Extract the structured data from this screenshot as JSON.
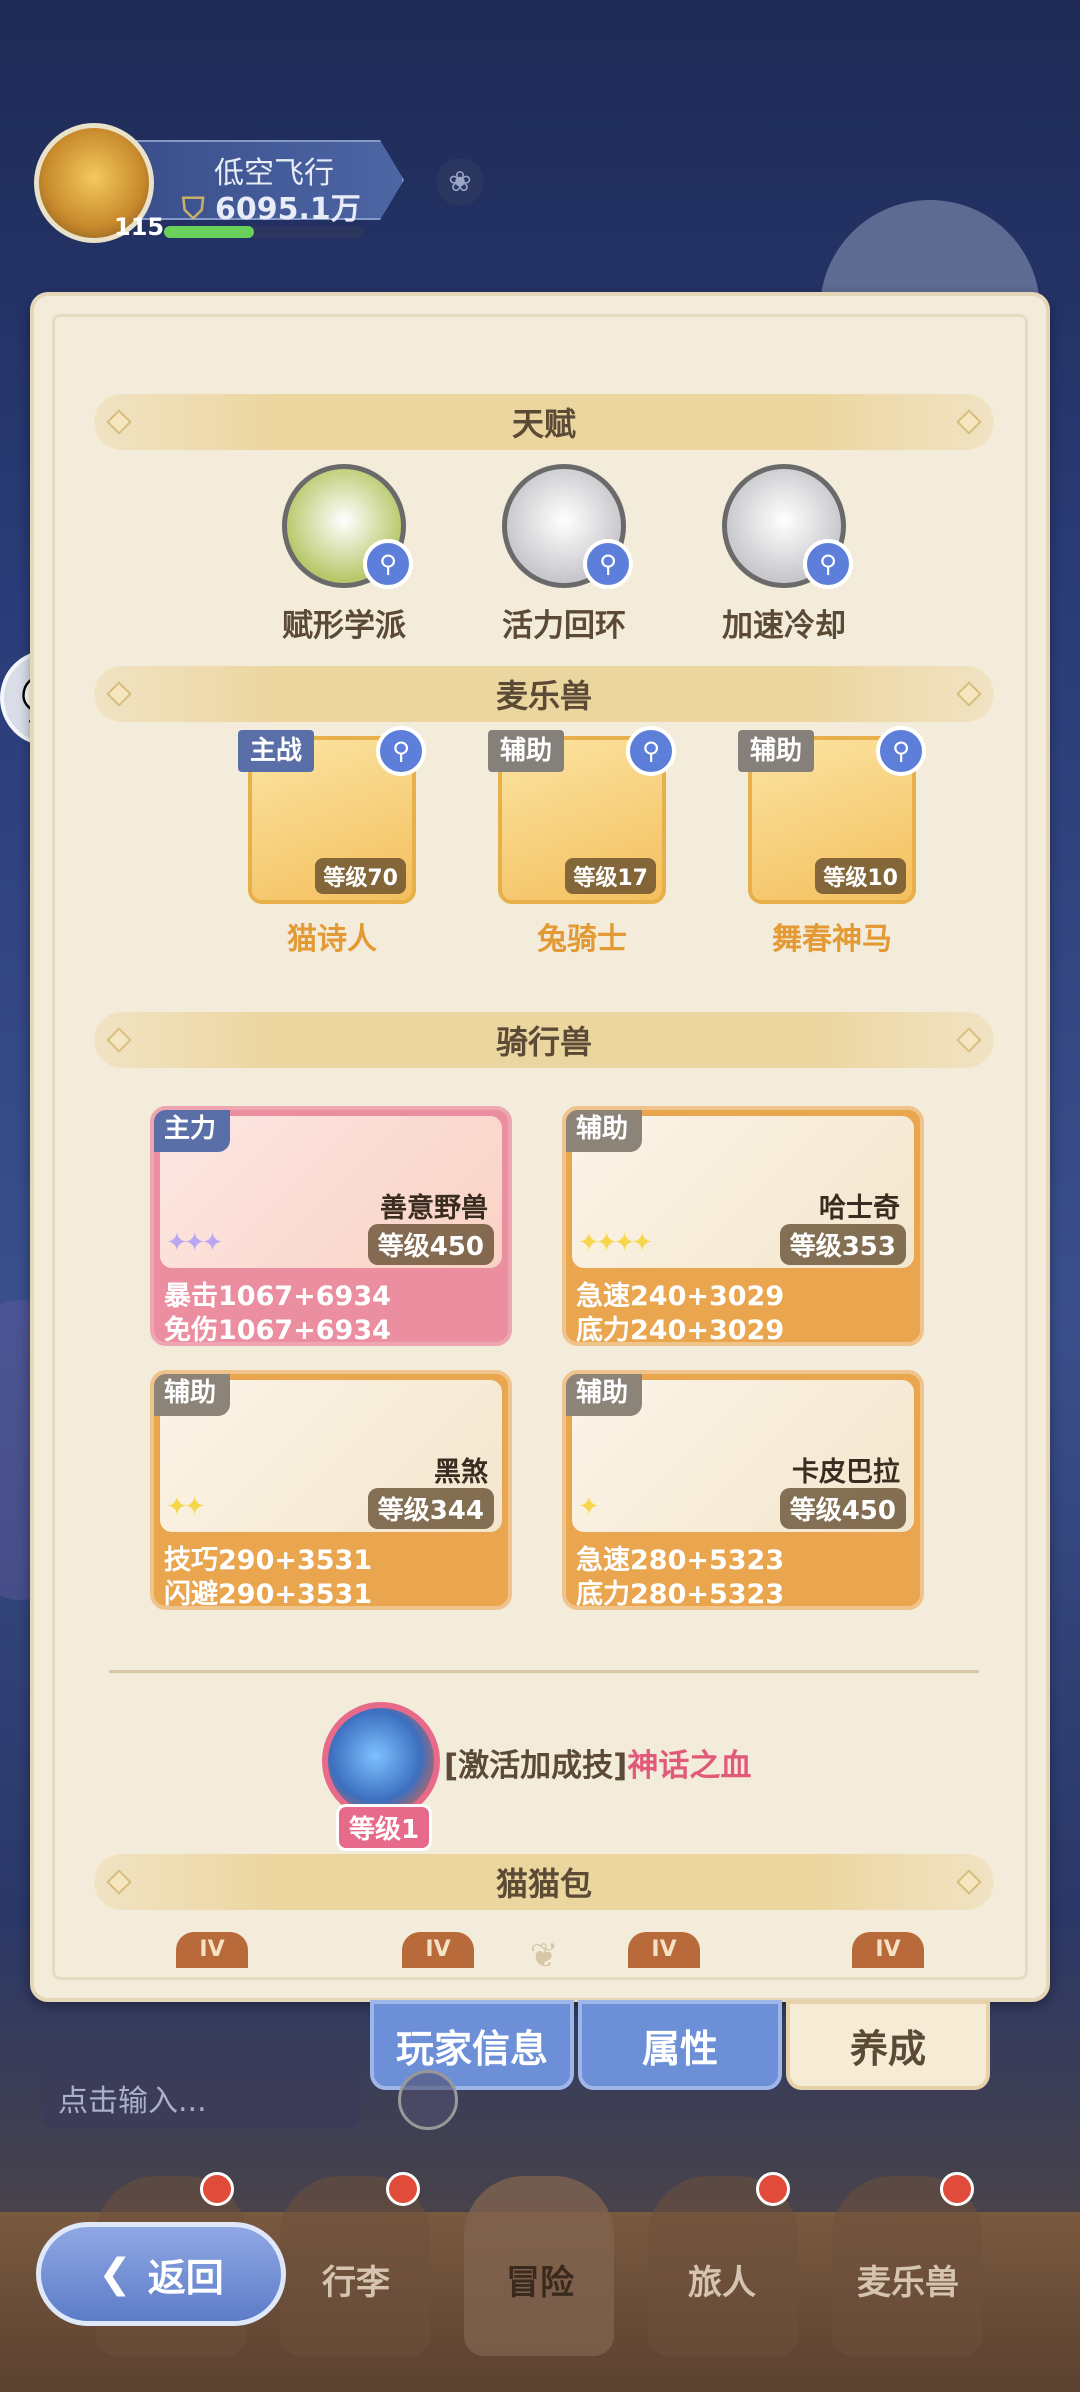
{
  "player": {
    "name": "低空飞行",
    "power": "6095.1万",
    "level": "115",
    "xp_fraction": 0.45
  },
  "sections": {
    "talent": "天赋",
    "pets": "麦乐兽",
    "mounts": "骑行兽",
    "bag": "猫猫包"
  },
  "talents": [
    {
      "label": "赋形学派",
      "icon": "gem-crest-icon",
      "color": "#b7c86a"
    },
    {
      "label": "活力回环",
      "icon": "star-burst-icon",
      "color": "#c8c8cc"
    },
    {
      "label": "加速冷却",
      "icon": "wing-icon",
      "color": "#c8c8cc"
    }
  ],
  "pets": [
    {
      "tag": "主战",
      "name": "猫诗人",
      "level": "等级70"
    },
    {
      "tag": "辅助",
      "name": "兔骑士",
      "level": "等级17"
    },
    {
      "tag": "辅助",
      "name": "舞春神马",
      "level": "等级10"
    }
  ],
  "mounts": [
    {
      "tag": "主力",
      "name": "善意野兽",
      "level": "等级450",
      "stat1": "暴击1067+6934",
      "stat2": "免伤1067+6934",
      "stars": "✦✦✦"
    },
    {
      "tag": "辅助",
      "name": "哈士奇",
      "level": "等级353",
      "stat1": "急速240+3029",
      "stat2": "底力240+3029",
      "stars": "✦✦✦✦"
    },
    {
      "tag": "辅助",
      "name": "黑煞",
      "level": "等级344",
      "stat1": "技巧290+3531",
      "stat2": "闪避290+3531",
      "stars": "✦✦"
    },
    {
      "tag": "辅助",
      "name": "卡皮巴拉",
      "level": "等级450",
      "stat1": "急速280+5323",
      "stat2": "底力280+5323",
      "stars": "✦"
    }
  ],
  "skill": {
    "prefix": "[激活加成技]",
    "name": "神话之血",
    "level": "等级1"
  },
  "bag_tabs": [
    "IV",
    "IV",
    "IV",
    "IV"
  ],
  "panel_tabs": {
    "player_info": "玩家信息",
    "attributes": "属性",
    "cultivation": "养成"
  },
  "chat_input": {
    "placeholder": "点击输入..."
  },
  "nav": {
    "back": "返回",
    "items": [
      "行李",
      "冒险",
      "旅人",
      "麦乐兽"
    ]
  }
}
